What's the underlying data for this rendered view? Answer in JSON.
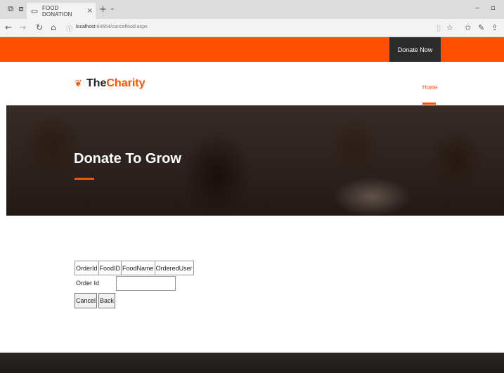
{
  "browser": {
    "tab_title": "FOOD DONATION",
    "tab_close": "×",
    "new_tab": "+",
    "tab_menu": "⌄",
    "url_host": "localhost",
    "url_rest": ":64654/cancelfood.aspx",
    "window_min": "–",
    "window_max": "▫"
  },
  "site": {
    "donate_label": "Donate Now",
    "logo_part1": "The",
    "logo_part2": "Charity",
    "nav_home": "Home",
    "hero_title": "Donate To Grow"
  },
  "grid": {
    "columns": [
      "OrderId",
      "FoodID",
      "FoodName",
      "OrderedUser"
    ]
  },
  "form": {
    "orderid_label": "Order Id",
    "orderid_value": "",
    "cancel_label": "Cancel",
    "back_label": "Back"
  },
  "colors": {
    "accent": "#ff4f00",
    "donate_bg": "#2c2c2c"
  }
}
